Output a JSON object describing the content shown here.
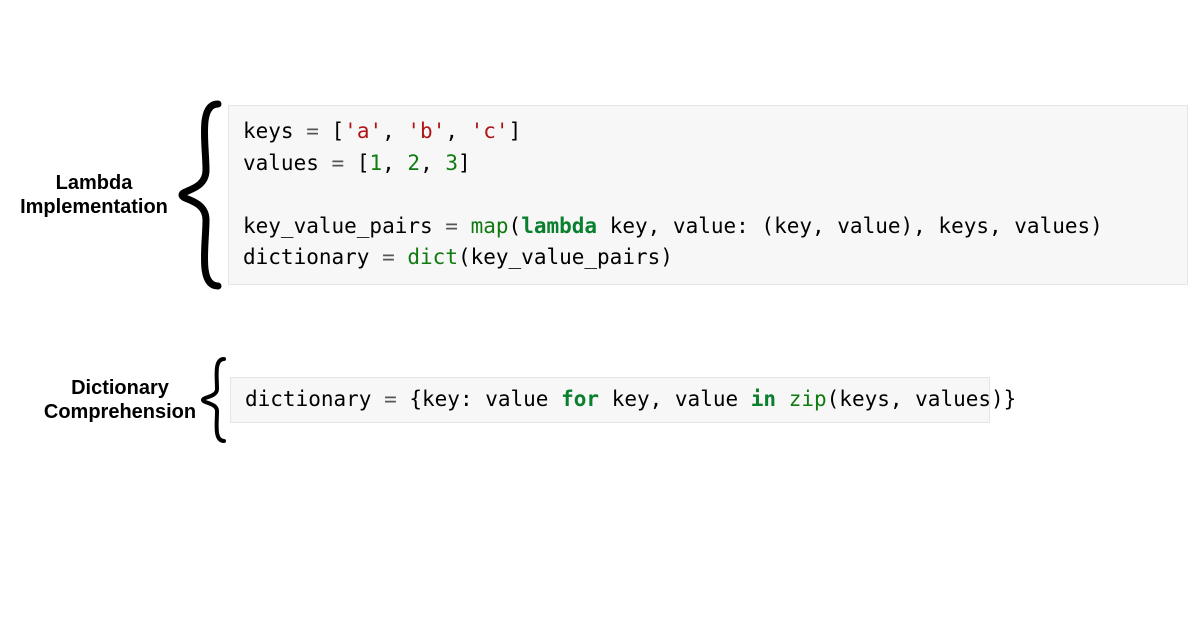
{
  "sections": [
    {
      "label": "Lambda\nImplementation",
      "code_tokens": [
        [
          {
            "t": "keys ",
            "c": ""
          },
          {
            "t": "=",
            "c": "tok-op"
          },
          {
            "t": " [",
            "c": ""
          },
          {
            "t": "'a'",
            "c": "tok-str"
          },
          {
            "t": ", ",
            "c": ""
          },
          {
            "t": "'b'",
            "c": "tok-str"
          },
          {
            "t": ", ",
            "c": ""
          },
          {
            "t": "'c'",
            "c": "tok-str"
          },
          {
            "t": "]",
            "c": ""
          }
        ],
        [
          {
            "t": "values ",
            "c": ""
          },
          {
            "t": "=",
            "c": "tok-op"
          },
          {
            "t": " [",
            "c": ""
          },
          {
            "t": "1",
            "c": "tok-num"
          },
          {
            "t": ", ",
            "c": ""
          },
          {
            "t": "2",
            "c": "tok-num"
          },
          {
            "t": ", ",
            "c": ""
          },
          {
            "t": "3",
            "c": "tok-num"
          },
          {
            "t": "]",
            "c": ""
          }
        ],
        [],
        [
          {
            "t": "key_value_pairs ",
            "c": ""
          },
          {
            "t": "=",
            "c": "tok-op"
          },
          {
            "t": " ",
            "c": ""
          },
          {
            "t": "map",
            "c": "tok-builtin"
          },
          {
            "t": "(",
            "c": ""
          },
          {
            "t": "lambda",
            "c": "tok-kw"
          },
          {
            "t": " key, value: (key, value), keys, values)",
            "c": ""
          }
        ],
        [
          {
            "t": "dictionary ",
            "c": ""
          },
          {
            "t": "=",
            "c": "tok-op"
          },
          {
            "t": " ",
            "c": ""
          },
          {
            "t": "dict",
            "c": "tok-builtin"
          },
          {
            "t": "(key_value_pairs)",
            "c": ""
          }
        ]
      ]
    },
    {
      "label": "Dictionary\nComprehension",
      "code_tokens": [
        [
          {
            "t": "dictionary ",
            "c": ""
          },
          {
            "t": "=",
            "c": "tok-op"
          },
          {
            "t": " {key: value ",
            "c": ""
          },
          {
            "t": "for",
            "c": "tok-kw"
          },
          {
            "t": " key, value ",
            "c": ""
          },
          {
            "t": "in",
            "c": "tok-kw"
          },
          {
            "t": " ",
            "c": ""
          },
          {
            "t": "zip",
            "c": "tok-builtin"
          },
          {
            "t": "(keys, values)}",
            "c": ""
          }
        ]
      ]
    }
  ]
}
